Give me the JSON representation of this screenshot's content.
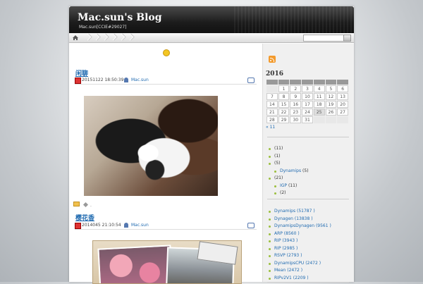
{
  "header": {
    "title": "Mac.sun's Blog",
    "description": "Mac.sun[CCIE#29027]"
  },
  "posts": [
    {
      "title": "闲聊",
      "date": "20151122 18:50:39",
      "author": "Mac.sun",
      "footer_text": "."
    },
    {
      "title": "樱花香",
      "date": "2014045 21:10:54",
      "author": "Mac.sun"
    }
  ],
  "sidebar": {
    "calendar": {
      "year": "2016",
      "weeks": [
        [
          "",
          "1",
          "2",
          "3",
          "4",
          "5",
          "6"
        ],
        [
          "7",
          "8",
          "9",
          "10",
          "11",
          "12",
          "13"
        ],
        [
          "14",
          "15",
          "16",
          "17",
          "18",
          "19",
          "20"
        ],
        [
          "21",
          "22",
          "23",
          "24",
          "25",
          "26",
          "27"
        ],
        [
          "28",
          "29",
          "30",
          "31",
          "",
          "",
          ""
        ]
      ],
      "prev_link": "« 11"
    },
    "categories": [
      {
        "label": "(11)"
      },
      {
        "label": "(1)"
      },
      {
        "label": "(5)"
      },
      {
        "label": "Dynamips",
        "count": "(5)",
        "sub": true
      },
      {
        "label": "(21)"
      },
      {
        "label": "IGP",
        "count": "(11)",
        "sub": true
      },
      {
        "label": "(2)",
        "sub": true
      }
    ],
    "tags": [
      "Dynamips (51787 )",
      "Dynagen (13838 )",
      "DynamipsDynagen (9561 )",
      "ARP (8560 )",
      "RIP (3943 )",
      "RIP (2985 )",
      "RSVP (2793 )",
      "DynamipsCPU (2472 )",
      "Mean (2472 )",
      "RIPv2V1 (2209 )"
    ]
  }
}
